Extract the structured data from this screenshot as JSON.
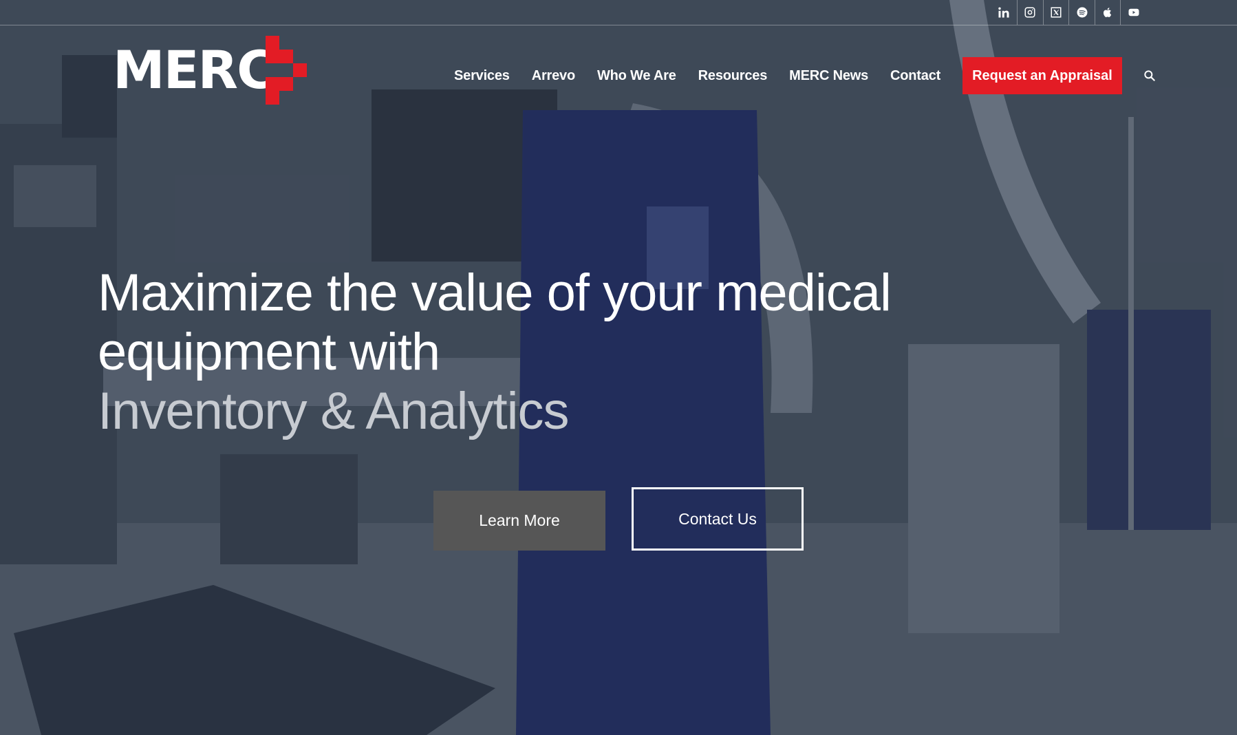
{
  "brand": {
    "logo_text": "MERC",
    "accent_color": "#e31c25"
  },
  "social": [
    {
      "name": "linkedin-icon"
    },
    {
      "name": "instagram-icon"
    },
    {
      "name": "x-twitter-icon"
    },
    {
      "name": "spotify-icon"
    },
    {
      "name": "apple-podcasts-icon"
    },
    {
      "name": "youtube-icon"
    }
  ],
  "nav": {
    "items": [
      "Services",
      "Arrevo",
      "Who We Are",
      "Resources",
      "MERC News",
      "Contact"
    ],
    "cta": "Request an Appraisal"
  },
  "hero": {
    "line1": "Maximize the value of your medical",
    "line2": "equipment with",
    "line3": "Inventory & Analytics",
    "learn_more": "Learn More",
    "contact_us": "Contact Us"
  }
}
